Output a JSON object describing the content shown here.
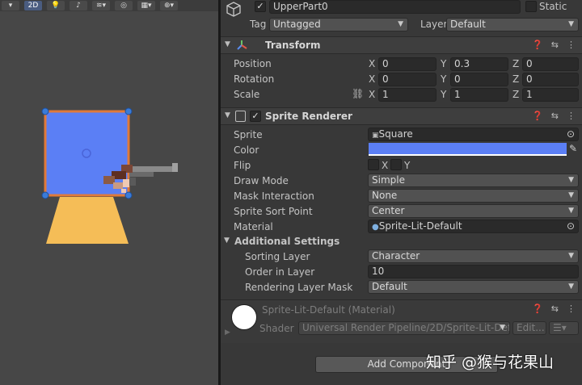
{
  "scene": {
    "toolbar": {
      "mode_2d_label": "2D",
      "items": [
        "light-bulb-icon",
        "audio-icon",
        "layers-icon",
        "visibility-icon",
        "render-mode-icon",
        "gizmos-icon"
      ]
    },
    "colors": {
      "sprite_blue": "#5b7ff5",
      "selection_orange": "#e07a3a",
      "cone_yellow": "#f5bd57"
    }
  },
  "header": {
    "name": "UpperPart0",
    "static_label": "Static",
    "tag_label": "Tag",
    "tag_value": "Untagged",
    "layer_label": "Layer",
    "layer_value": "Default"
  },
  "transform": {
    "title": "Transform",
    "position_label": "Position",
    "rotation_label": "Rotation",
    "scale_label": "Scale",
    "axes": [
      "X",
      "Y",
      "Z"
    ],
    "position": [
      "0",
      "0.3",
      "0"
    ],
    "rotation": [
      "0",
      "0",
      "0"
    ],
    "scale": [
      "1",
      "1",
      "1"
    ]
  },
  "sprite_renderer": {
    "title": "Sprite Renderer",
    "sprite_label": "Sprite",
    "sprite_value": "Square",
    "color_label": "Color",
    "color_value": "#5b7ff5",
    "flip_label": "Flip",
    "flip_x": "X",
    "flip_y": "Y",
    "draw_mode_label": "Draw Mode",
    "draw_mode_value": "Simple",
    "mask_label": "Mask Interaction",
    "mask_value": "None",
    "sort_point_label": "Sprite Sort Point",
    "sort_point_value": "Center",
    "material_label": "Material",
    "material_value": "Sprite-Lit-Default",
    "additional_label": "Additional Settings",
    "sorting_layer_label": "Sorting Layer",
    "sorting_layer_value": "Character",
    "order_label": "Order in Layer",
    "order_value": "10",
    "rendering_mask_label": "Rendering Layer Mask",
    "rendering_mask_value": "Default"
  },
  "material": {
    "name": "Sprite-Lit-Default (Material)",
    "shader_label": "Shader",
    "shader_value": "Universal Render Pipeline/2D/Sprite-Lit-Defau",
    "edit_label": "Edit..."
  },
  "add_component_label": "Add Component",
  "watermark": "知乎 @猴与花果山"
}
